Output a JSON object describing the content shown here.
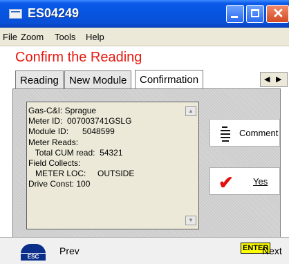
{
  "window": {
    "title": "ES04249"
  },
  "menu": {
    "items": [
      {
        "label": "File"
      },
      {
        "label": "Zoom"
      },
      {
        "label": "Tools"
      },
      {
        "label": "Help"
      }
    ]
  },
  "page": {
    "heading": "Confirm the Reading"
  },
  "tabs": [
    {
      "label": "Reading"
    },
    {
      "label": "New Module"
    },
    {
      "label": "Confirmation",
      "active": true
    }
  ],
  "details": {
    "lines": [
      "Gas-C&I: Sprague",
      "Meter ID:  007003741GSLG",
      "Module ID:      5048599",
      "Meter Reads:",
      "   Total CUM read:  54321",
      "Field Collects:",
      "   METER LOC:     OUTSIDE",
      "Drive Const: 100"
    ]
  },
  "actions": {
    "comment_label": "Comment",
    "yes_label": "Yes"
  },
  "footer": {
    "esc_label": "ESC",
    "prev_label": "Prev",
    "enter_label": "ENTER",
    "next_label": "Next"
  },
  "colors": {
    "heading": "#e8170f",
    "titlebar": "#0654e0",
    "check": "#e21010"
  }
}
